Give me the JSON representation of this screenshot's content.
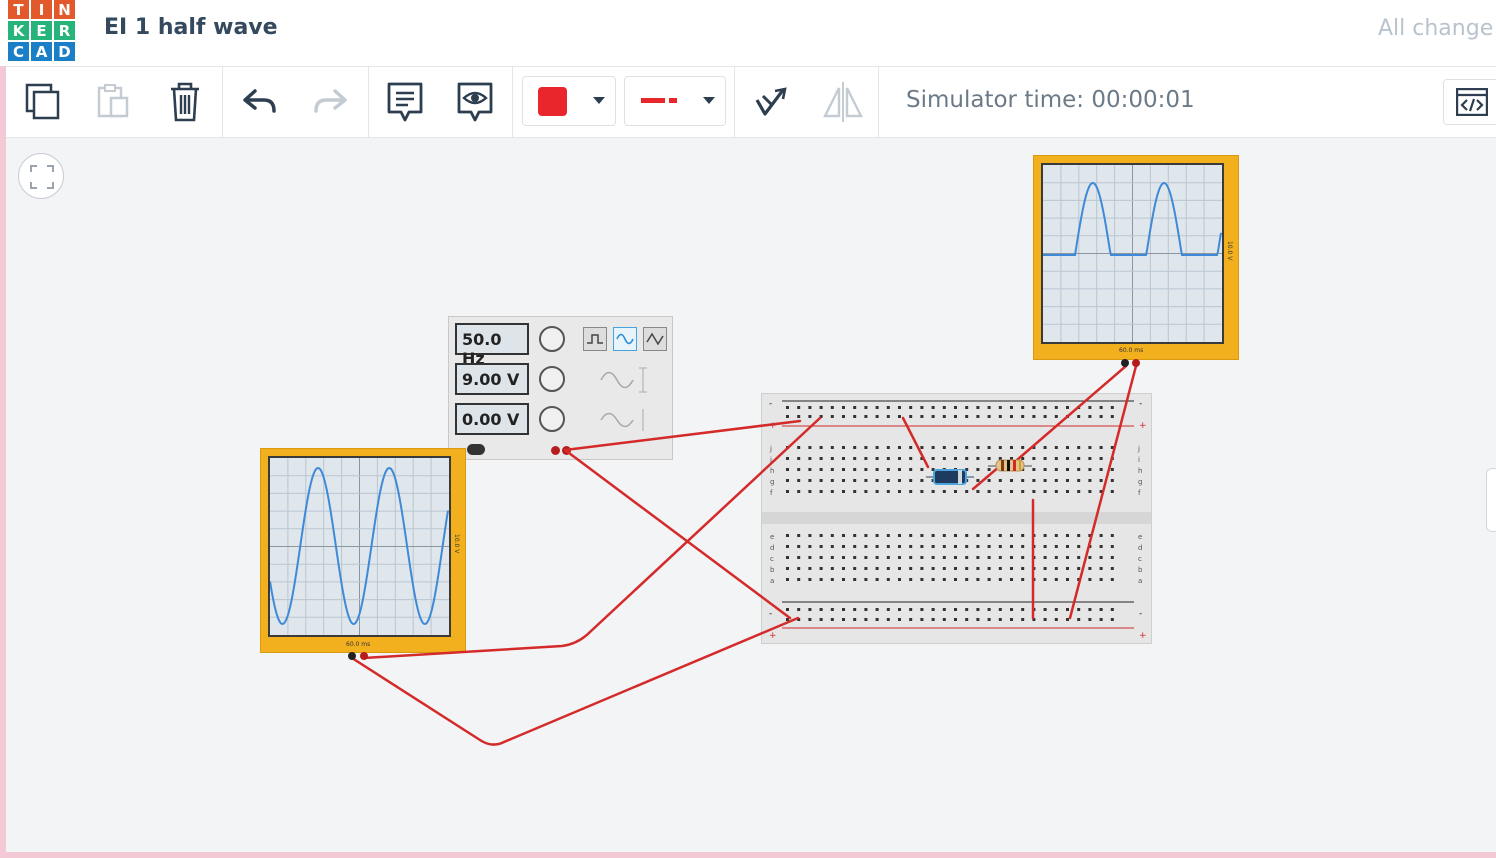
{
  "app": {
    "logo_letters": [
      "T",
      "I",
      "N",
      "K",
      "E",
      "R",
      "C",
      "A",
      "D"
    ],
    "logo_colors": [
      "#e2592c",
      "#e2592c",
      "#e2592c",
      "#26b47b",
      "#26b47b",
      "#26b47b",
      "#1b7fc8",
      "#1b7fc8",
      "#1b7fc8"
    ],
    "design_title": "EI 1 half wave",
    "save_status": "All change"
  },
  "toolbar": {
    "copy_icon": "copy-icon",
    "paste_icon": "paste-icon",
    "delete_icon": "trash-icon",
    "undo_icon": "undo-icon",
    "redo_icon": "redo-icon",
    "notes_icon": "notes-icon",
    "visibility_icon": "eye-icon",
    "wire_color": "#e8262c",
    "wire_type_icon": "dashed-line-icon",
    "rotate_icon": "rotate-icon",
    "flip_icon": "flip-icon",
    "simulator_time": "Simulator time: 00:00:01",
    "code_icon": "code-window-icon"
  },
  "function_generator": {
    "frequency": "50.0 Hz",
    "amplitude": "9.00 V",
    "dc_offset": "0.00 V",
    "selected_waveform": "sine"
  },
  "oscilloscope_input": {
    "time_per_division": "60.0 ms",
    "volts_per_division": "10.0 V"
  },
  "oscilloscope_output": {
    "time_per_division": "60.0 ms",
    "volts_per_division": "10.0 V"
  },
  "breadboard": {
    "rail_minus": "-",
    "rail_plus": "+",
    "row_letters_top": [
      "f",
      "g",
      "h",
      "i",
      "j"
    ],
    "row_letters_bottom": [
      "a",
      "b",
      "c",
      "d",
      "e"
    ],
    "column_count": 30
  },
  "colors": {
    "wire": "#d42a2a",
    "trace": "#3f8ad8",
    "scope_frame": "#f2b01e"
  }
}
